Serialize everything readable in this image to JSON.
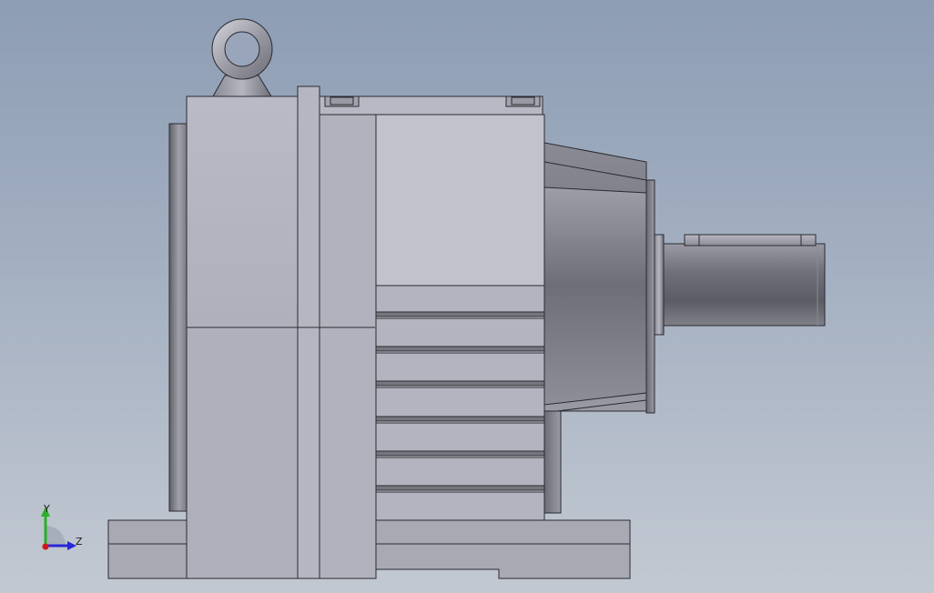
{
  "triad": {
    "y_label": "Y",
    "z_label": "Z",
    "colors": {
      "x_axis": "#d01818",
      "y_axis": "#28b028",
      "z_axis": "#2828d8"
    }
  },
  "colors": {
    "background_top": "#8d9db4",
    "background_bottom": "#c3c9d2",
    "housing_face": "#b0b0bc",
    "housing_light": "#c2c2cc",
    "base_face": "#a9a9b4",
    "outline": "#2a2a30"
  }
}
